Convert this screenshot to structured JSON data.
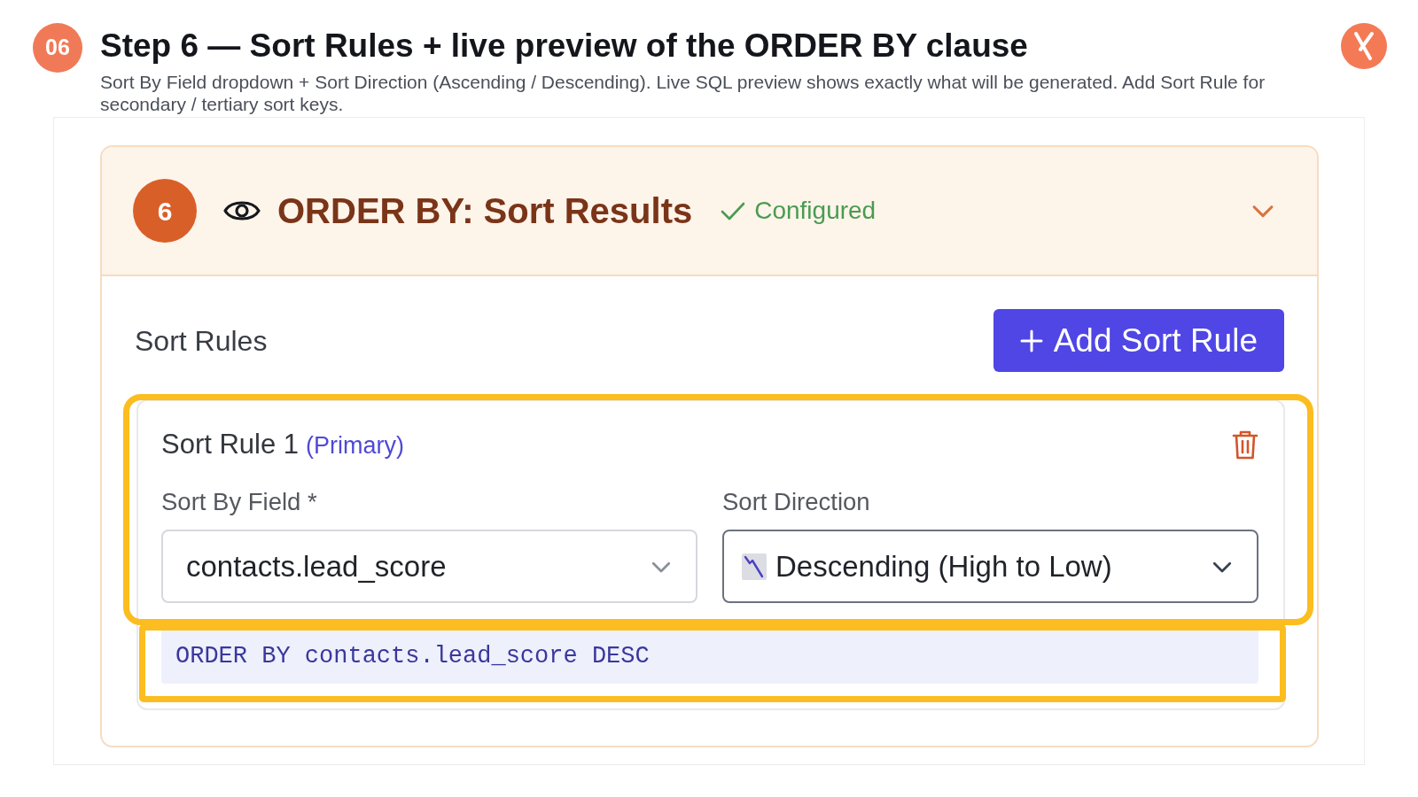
{
  "step": {
    "number": "06",
    "title": "Step 6 — Sort Rules + live preview of the ORDER BY clause",
    "description": "Sort By Field dropdown + Sort Direction (Ascending / Descending). Live SQL preview shows exactly what will be generated. Add Sort Rule for secondary / tertiary sort keys."
  },
  "panel": {
    "number": "6",
    "title": "ORDER BY: Sort Results",
    "status": "Configured",
    "configured": true,
    "expanded": true
  },
  "section": {
    "title": "Sort Rules",
    "add_button": "Add Sort Rule"
  },
  "sort_rules": [
    {
      "title": "Sort Rule 1",
      "tag": "(Primary)",
      "highlighted": true,
      "fields": [
        {
          "kind": "field",
          "label": "Sort By Field *",
          "value": "contacts.lead_score",
          "focused": false
        },
        {
          "kind": "direction",
          "label": "Sort Direction",
          "value": "Descending (High to Low)",
          "focused": true
        }
      ],
      "preview": {
        "text": "ORDER BY contacts.lead_score DESC",
        "highlighted": true
      }
    }
  ]
}
